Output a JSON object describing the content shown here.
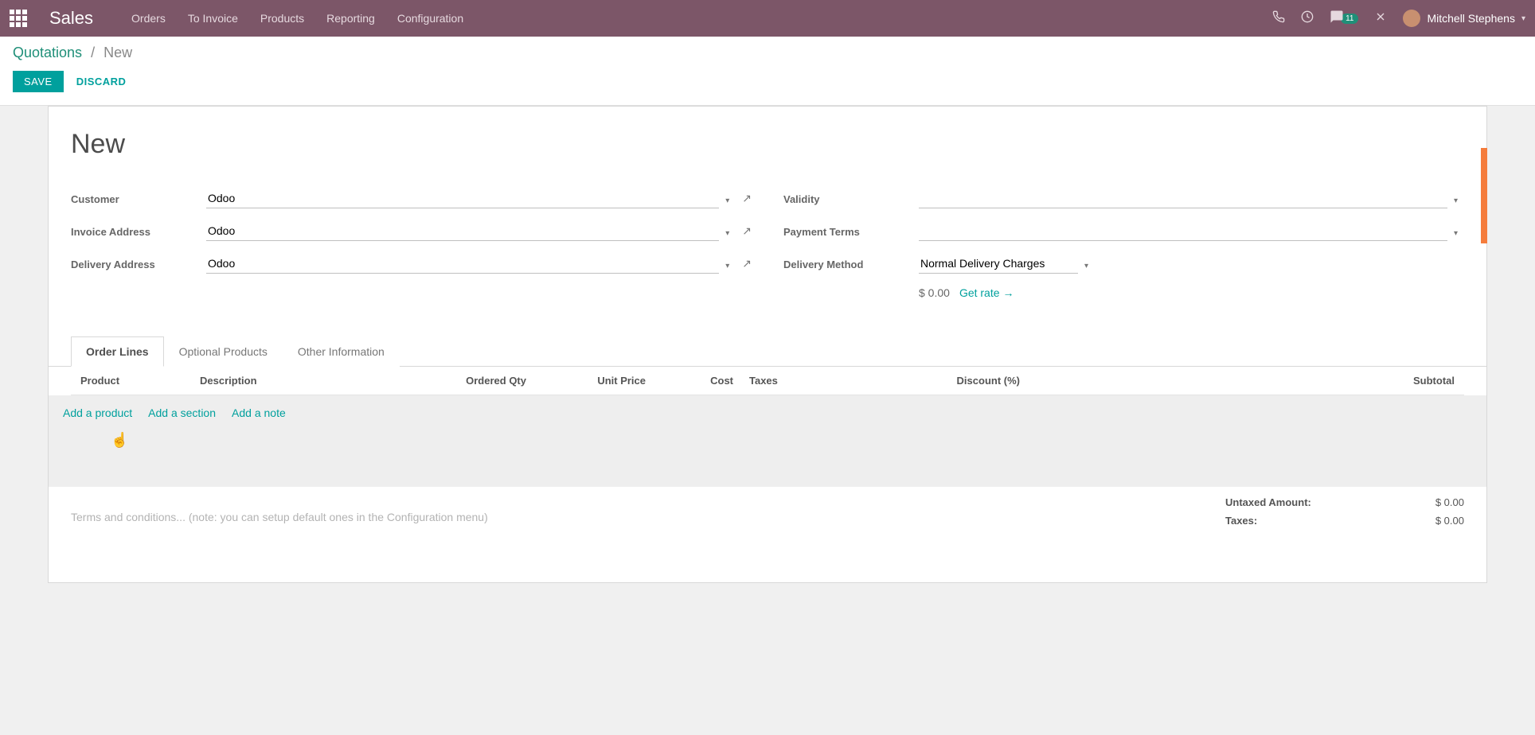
{
  "navbar": {
    "brand": "Sales",
    "items": [
      "Orders",
      "To Invoice",
      "Products",
      "Reporting",
      "Configuration"
    ],
    "chat_badge": "11",
    "user_name": "Mitchell Stephens"
  },
  "control": {
    "breadcrumb_parent": "Quotations",
    "breadcrumb_current": "New",
    "save": "SAVE",
    "discard": "DISCARD"
  },
  "form": {
    "title": "New",
    "labels": {
      "customer": "Customer",
      "invoice_address": "Invoice Address",
      "delivery_address": "Delivery Address",
      "validity": "Validity",
      "payment_terms": "Payment Terms",
      "delivery_method": "Delivery Method"
    },
    "values": {
      "customer": "Odoo",
      "invoice_address": "Odoo",
      "delivery_address": "Odoo",
      "validity": "",
      "payment_terms": "",
      "delivery_method": "Normal Delivery Charges",
      "delivery_price": "$ 0.00",
      "get_rate": "Get rate"
    }
  },
  "tabs": [
    "Order Lines",
    "Optional Products",
    "Other Information"
  ],
  "table": {
    "headers": {
      "product": "Product",
      "description": "Description",
      "ordered_qty": "Ordered Qty",
      "unit_price": "Unit Price",
      "cost": "Cost",
      "taxes": "Taxes",
      "discount": "Discount (%)",
      "subtotal": "Subtotal"
    },
    "add_product": "Add a product",
    "add_section": "Add a section",
    "add_note": "Add a note"
  },
  "footer": {
    "terms_placeholder": "Terms and conditions... (note: you can setup default ones in the Configuration menu)",
    "untaxed_label": "Untaxed Amount:",
    "untaxed_value": "$ 0.00",
    "taxes_label": "Taxes:",
    "taxes_value": "$ 0.00"
  }
}
